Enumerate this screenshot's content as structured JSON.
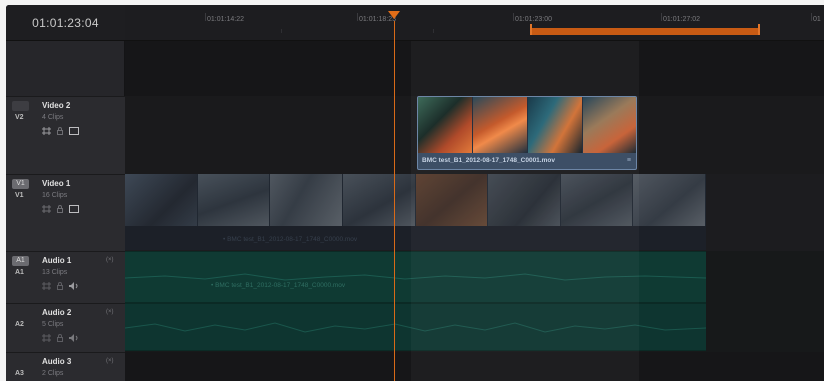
{
  "timecode": "01:01:23:04",
  "ruler": {
    "labels": [
      "01:01:14:22",
      "01:01:18:23",
      "01:01:23:00",
      "01:01:27:02",
      "01"
    ]
  },
  "tracks": {
    "v2": {
      "tag": "",
      "id": "V2",
      "name": "Video 2",
      "clips": "4 Clips"
    },
    "v1": {
      "tag": "V1",
      "id": "V1",
      "name": "Video 1",
      "clips": "16 Clips"
    },
    "a1": {
      "tag": "A1",
      "id": "A1",
      "name": "Audio 1",
      "clips": "13 Clips",
      "channels": "(×)"
    },
    "a2": {
      "tag": "",
      "id": "A2",
      "name": "Audio 2",
      "clips": "5 Clips",
      "channels": "(×)"
    },
    "a3": {
      "tag": "",
      "id": "A3",
      "name": "Audio 3",
      "clips": "2 Clips",
      "channels": "(×)"
    }
  },
  "clips": {
    "v2_label": "BMC test_B1_2012-08-17_1748_C0001.mov",
    "v1_label": "• BMC test_B1_2012-08-17_1748_C0000.mov",
    "a1_label": "• BMC test_B1_2012-08-17_1748_C0000.mov"
  },
  "colors": {
    "accent": "#d86a18",
    "video_clip": "#3d4f66",
    "audio_clip": "#0f3a33"
  }
}
